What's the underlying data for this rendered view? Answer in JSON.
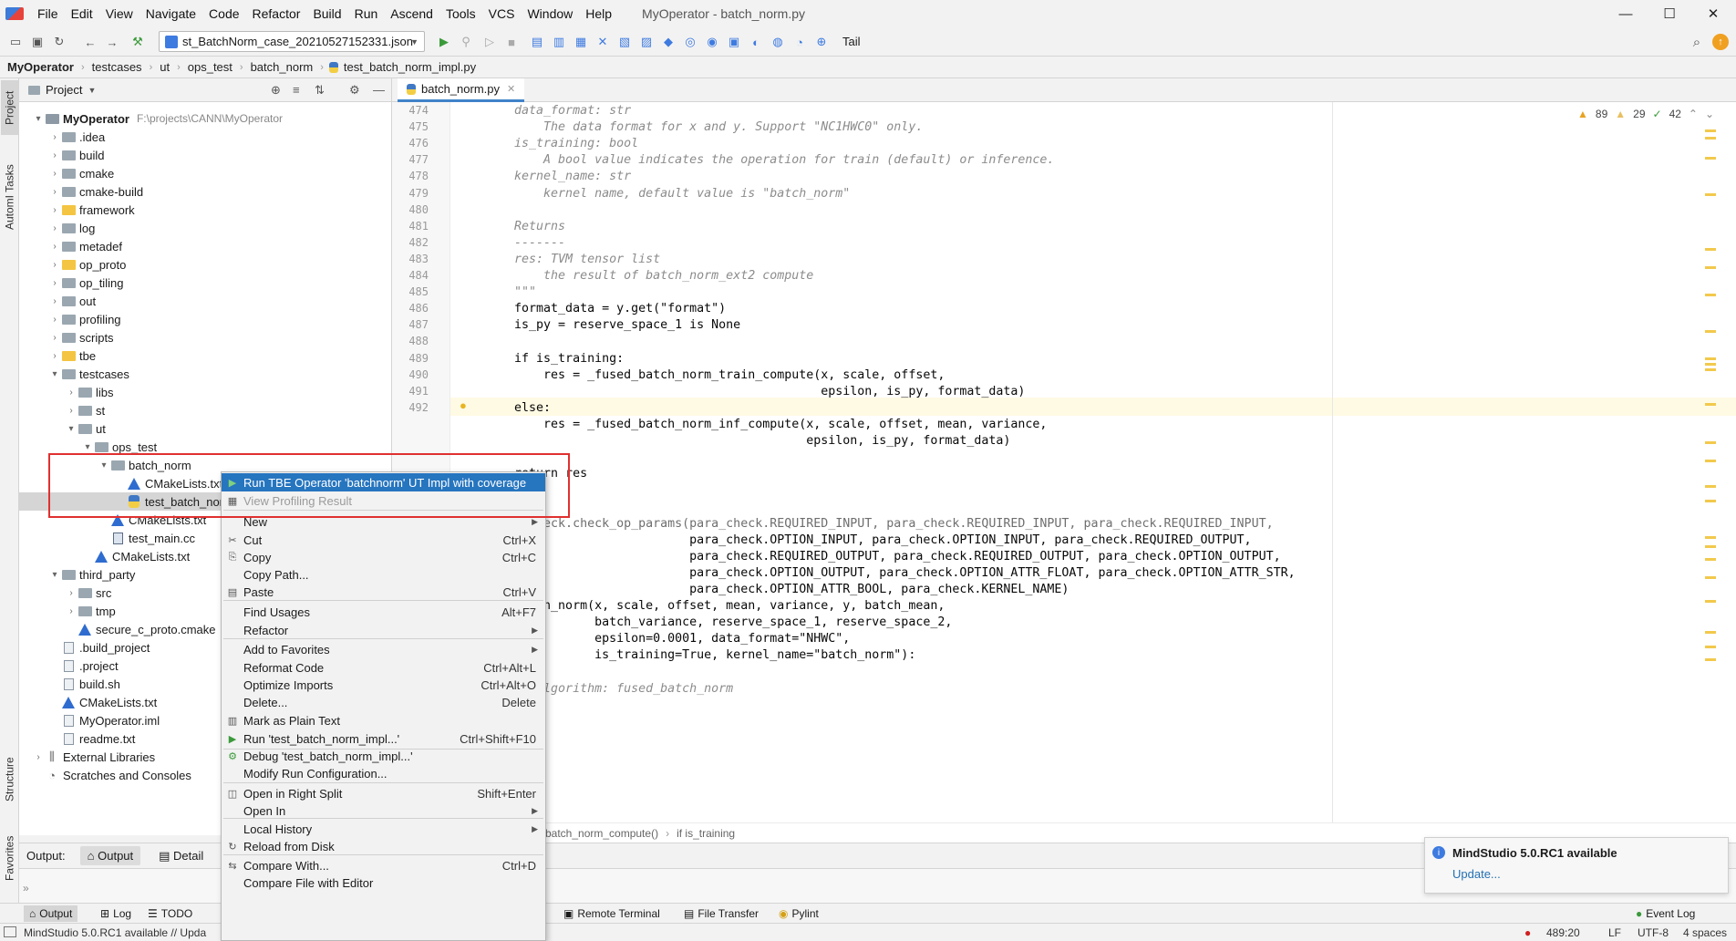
{
  "menubar": {
    "items": [
      "File",
      "Edit",
      "View",
      "Navigate",
      "Code",
      "Refactor",
      "Build",
      "Run",
      "Ascend",
      "Tools",
      "VCS",
      "Window",
      "Help"
    ],
    "window_title": "MyOperator - batch_norm.py",
    "minimize": "—",
    "maximize": "☐",
    "close": "✕"
  },
  "toolbar": {
    "run_config": "st_BatchNorm_case_20210527152331.json",
    "tail_label": "Tail"
  },
  "navbar": {
    "crumbs": [
      "MyOperator",
      "testcases",
      "ut",
      "ops_test",
      "batch_norm",
      "test_batch_norm_impl.py"
    ]
  },
  "leftstrip": {
    "project": "Project",
    "automl": "AutomI Tasks",
    "structure": "Structure",
    "favorites": "Favorites"
  },
  "project_panel": {
    "title": "Project",
    "tree": [
      {
        "label": "MyOperator",
        "path": "F:\\projects\\CANN\\MyOperator",
        "type": "folder"
      },
      {
        "label": ".idea",
        "type": "folder"
      },
      {
        "label": "build",
        "type": "folder"
      },
      {
        "label": "cmake",
        "type": "folder"
      },
      {
        "label": "cmake-build",
        "type": "folder"
      },
      {
        "label": "framework",
        "type": "folder-yellow"
      },
      {
        "label": "log",
        "type": "folder"
      },
      {
        "label": "metadef",
        "type": "folder"
      },
      {
        "label": "op_proto",
        "type": "folder-yellow"
      },
      {
        "label": "op_tiling",
        "type": "folder"
      },
      {
        "label": "out",
        "type": "folder"
      },
      {
        "label": "profiling",
        "type": "folder"
      },
      {
        "label": "scripts",
        "type": "folder"
      },
      {
        "label": "tbe",
        "type": "folder-yellow"
      },
      {
        "label": "testcases",
        "type": "folder"
      },
      {
        "label": "libs",
        "type": "folder"
      },
      {
        "label": "st",
        "type": "folder"
      },
      {
        "label": "ut",
        "type": "folder"
      },
      {
        "label": "ops_test",
        "type": "folder"
      },
      {
        "label": "batch_norm",
        "type": "folder"
      },
      {
        "label": "CMakeLists.txt",
        "type": "cmake"
      },
      {
        "label": "test_batch_norm_impl.py",
        "type": "py"
      },
      {
        "label": "CMakeLists.txt",
        "type": "cmake"
      },
      {
        "label": "test_main.cc",
        "type": "cc"
      },
      {
        "label": "CMakeLists.txt",
        "type": "cmake"
      },
      {
        "label": "third_party",
        "type": "folder"
      },
      {
        "label": "src",
        "type": "folder"
      },
      {
        "label": "tmp",
        "type": "folder"
      },
      {
        "label": "secure_c_proto.cmake",
        "type": "cmake"
      },
      {
        "label": ".build_project",
        "type": "gen"
      },
      {
        "label": ".project",
        "type": "gen"
      },
      {
        "label": "build.sh",
        "type": "gen"
      },
      {
        "label": "CMakeLists.txt",
        "type": "cmake"
      },
      {
        "label": "MyOperator.iml",
        "type": "gen"
      },
      {
        "label": "readme.txt",
        "type": "gen"
      },
      {
        "label": "External Libraries",
        "type": "lib"
      },
      {
        "label": "Scratches and Consoles",
        "type": "scratch"
      }
    ]
  },
  "editor": {
    "tab": "batch_norm.py",
    "inspections": {
      "warnings": "89",
      "weak": "29",
      "ok": "42"
    },
    "lines": [
      {
        "n": "474",
        "text": "    data_format: str"
      },
      {
        "n": "475",
        "text": "        The data format for x and y. Support \"NC1HWC0\" only."
      },
      {
        "n": "476",
        "text": "    is_training: bool"
      },
      {
        "n": "477",
        "text": "        A bool value indicates the operation for train (default) or inference."
      },
      {
        "n": "478",
        "text": "    kernel_name: str"
      },
      {
        "n": "479",
        "text": "        kernel name, default value is \"batch_norm\""
      },
      {
        "n": "480",
        "text": ""
      },
      {
        "n": "481",
        "text": "    Returns"
      },
      {
        "n": "482",
        "text": "    -------"
      },
      {
        "n": "483",
        "text": "    res: TVM tensor list"
      },
      {
        "n": "484",
        "text": "        the result of batch_norm_ext2 compute"
      },
      {
        "n": "485",
        "text": "    \"\"\""
      },
      {
        "n": "486",
        "text": "    format_data = y.get(\"format\")"
      },
      {
        "n": "487",
        "text": "    is_py = reserve_space_1 is None"
      },
      {
        "n": "488",
        "text": ""
      },
      {
        "n": "489",
        "text": "    if is_training:"
      },
      {
        "n": "490",
        "text": "        res = _fused_batch_norm_train_compute(x, scale, offset,"
      },
      {
        "n": "491",
        "text": "                                              epsilon, is_py, format_data)"
      },
      {
        "n": "492",
        "text": "    else:"
      },
      {
        "n": "",
        "text": "        res = _fused_batch_norm_inf_compute(x, scale, offset, mean, variance,"
      },
      {
        "n": "",
        "text": "                                            epsilon, is_py, format_data)"
      },
      {
        "n": "",
        "text": ""
      },
      {
        "n": "",
        "text": "    return res"
      },
      {
        "n": "",
        "text": ""
      },
      {
        "n": "",
        "text": ""
      },
      {
        "n": "",
        "text": "@para_check.check_op_params(para_check.REQUIRED_INPUT, para_check.REQUIRED_INPUT, para_check.REQUIRED_INPUT,"
      },
      {
        "n": "",
        "text": "                            para_check.OPTION_INPUT, para_check.OPTION_INPUT, para_check.REQUIRED_OUTPUT,"
      },
      {
        "n": "",
        "text": "                            para_check.REQUIRED_OUTPUT, para_check.REQUIRED_OUTPUT, para_check.OPTION_OUTPUT,"
      },
      {
        "n": "",
        "text": "                            para_check.OPTION_OUTPUT, para_check.OPTION_ATTR_FLOAT, para_check.OPTION_ATTR_STR,"
      },
      {
        "n": "",
        "text": "                            para_check.OPTION_ATTR_BOOL, para_check.KERNEL_NAME)"
      },
      {
        "n": "",
        "text": "def batch_norm(x, scale, offset, mean, variance, y, batch_mean,"
      },
      {
        "n": "",
        "text": "               batch_variance, reserve_space_1, reserve_space_2,"
      },
      {
        "n": "",
        "text": "               epsilon=0.0001, data_format=\"NHWC\","
      },
      {
        "n": "",
        "text": "               is_training=True, kernel_name=\"batch_norm\"):"
      },
      {
        "n": "",
        "text": ""
      },
      {
        "n": "",
        "text": "    \"\"\"algorithm: fused_batch_norm"
      }
    ],
    "crumbs": [
      "batch_norm_compute()",
      "if is_training"
    ]
  },
  "context_menu": {
    "items": [
      {
        "label": "Run TBE Operator 'batchnorm' UT Impl with coverage",
        "shortcut": "",
        "icon": "run-icon",
        "active": true
      },
      {
        "label": "View Profiling Result",
        "shortcut": "",
        "icon": "profile-icon",
        "disabled": true
      },
      {
        "label": "New",
        "submenu": true
      },
      {
        "label": "Cut",
        "shortcut": "Ctrl+X",
        "icon": "cut-icon"
      },
      {
        "label": "Copy",
        "shortcut": "Ctrl+C",
        "icon": "copy-icon"
      },
      {
        "label": "Copy Path...",
        "shortcut": ""
      },
      {
        "label": "Paste",
        "shortcut": "Ctrl+V",
        "icon": "paste-icon"
      },
      {
        "label": "Find Usages",
        "shortcut": "Alt+F7"
      },
      {
        "label": "Refactor",
        "submenu": true
      },
      {
        "label": "Add to Favorites",
        "submenu": true
      },
      {
        "label": "Reformat Code",
        "shortcut": "Ctrl+Alt+L"
      },
      {
        "label": "Optimize Imports",
        "shortcut": "Ctrl+Alt+O"
      },
      {
        "label": "Delete...",
        "shortcut": "Delete"
      },
      {
        "label": "Mark as Plain Text",
        "icon": "plain-text-icon"
      },
      {
        "label": "Run 'test_batch_norm_impl...'",
        "shortcut": "Ctrl+Shift+F10",
        "icon": "run-icon"
      },
      {
        "label": "Debug 'test_batch_norm_impl...'",
        "icon": "debug-icon"
      },
      {
        "label": "Modify Run Configuration..."
      },
      {
        "label": "Open in Right Split",
        "shortcut": "Shift+Enter",
        "icon": "split-icon"
      },
      {
        "label": "Open In",
        "submenu": true
      },
      {
        "label": "Local History",
        "submenu": true
      },
      {
        "label": "Reload from Disk",
        "icon": "reload-icon"
      },
      {
        "label": "Compare With...",
        "shortcut": "Ctrl+D",
        "icon": "compare-icon"
      },
      {
        "label": "Compare File with Editor"
      }
    ]
  },
  "output_panel": {
    "label": "Output:",
    "tab_output": "Output",
    "tab_detail": "Detail"
  },
  "bottom_tools": {
    "output": "Output",
    "log": "Log",
    "todo": "TODO",
    "remote_terminal": "Remote Terminal",
    "file_transfer": "File Transfer",
    "pylint": "Pylint",
    "event_log": "Event Log"
  },
  "statusbar": {
    "message": "MindStudio 5.0.RC1 available // Upda",
    "position": "489:20",
    "line_sep": "LF",
    "encoding": "UTF-8",
    "indent": "4 spaces"
  },
  "notification": {
    "title": "MindStudio 5.0.RC1 available",
    "link": "Update..."
  },
  "colors": {
    "accent": "#2675bf",
    "annotation": "#e03030"
  }
}
